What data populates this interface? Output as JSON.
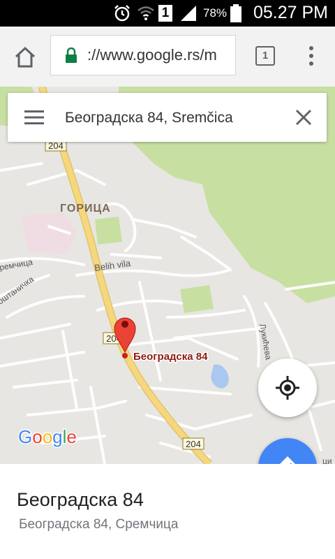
{
  "status_bar": {
    "battery_percent": "78%",
    "time": "05.27 PM",
    "sim_slot": "1"
  },
  "browser": {
    "url": "://www.google.rs/m",
    "tab_count": "1"
  },
  "search": {
    "query": "Београдска 84, Sremčica"
  },
  "map": {
    "road_shield_1": "204",
    "road_shield_2": "204",
    "road_shield_3": "204",
    "district_label": "ГОРИЦА",
    "street_belih_vila": "Belih vila",
    "street_left_1": "ремчица",
    "street_left_2": "оштаничка",
    "street_right_1": "Лукићева",
    "street_right_edge": "ци",
    "marker_label": "Београдска 84",
    "google_logo": "Google",
    "colors": {
      "park": "#c8dfa2",
      "road_major": "#f5d77e",
      "water": "#a9c8f0",
      "marker": "#ea4335"
    }
  },
  "place": {
    "title": "Београдска 84",
    "address": "Београдска 84, Сремчица"
  }
}
